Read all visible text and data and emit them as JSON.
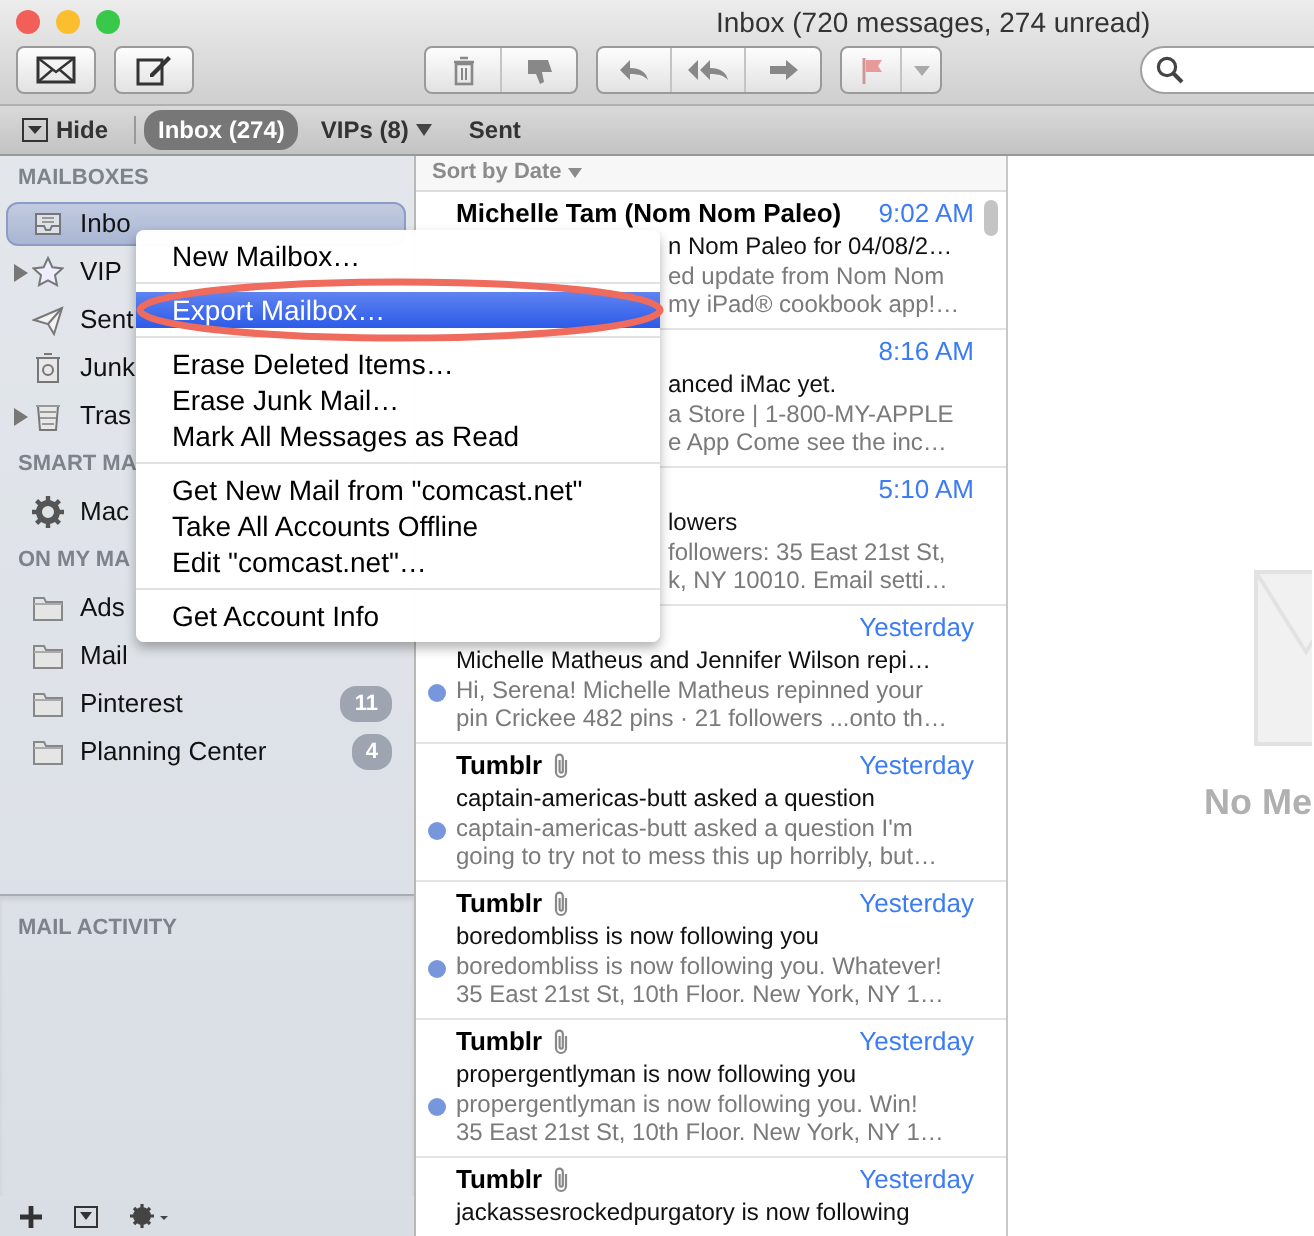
{
  "window": {
    "title": "Inbox (720 messages, 274 unread)"
  },
  "favorites_bar": {
    "hide": "Hide",
    "items": [
      {
        "label": "Inbox (274)",
        "selected": true,
        "has_menu": false
      },
      {
        "label": "VIPs (8)",
        "selected": false,
        "has_menu": true
      },
      {
        "label": "Sent",
        "selected": false,
        "has_menu": false
      }
    ]
  },
  "sidebar": {
    "sections": [
      {
        "heading": "MAILBOXES",
        "items": [
          {
            "label": "Inbo",
            "kind": "inbox",
            "selected": true,
            "disclosure": false
          },
          {
            "label": "VIP",
            "kind": "star",
            "selected": false,
            "disclosure": true
          },
          {
            "label": "Sent",
            "kind": "plane",
            "selected": false,
            "disclosure": false
          },
          {
            "label": "Junk",
            "kind": "junk",
            "selected": false,
            "disclosure": false
          },
          {
            "label": "Tras",
            "kind": "trash",
            "selected": false,
            "disclosure": true
          }
        ]
      },
      {
        "heading": "SMART MA",
        "items": [
          {
            "label": "Mac",
            "kind": "gear",
            "selected": false,
            "disclosure": false
          }
        ]
      },
      {
        "heading": "ON MY MA",
        "items": [
          {
            "label": "Ads",
            "kind": "folder",
            "selected": false,
            "disclosure": false
          },
          {
            "label": "Mail",
            "kind": "folder",
            "selected": false,
            "disclosure": false
          },
          {
            "label": "Pinterest",
            "kind": "folder",
            "selected": false,
            "disclosure": false,
            "count": "11"
          },
          {
            "label": "Planning Center",
            "kind": "folder",
            "selected": false,
            "disclosure": false,
            "count": "4"
          }
        ]
      }
    ],
    "activity_heading": "MAIL ACTIVITY"
  },
  "message_list": {
    "sort_label": "Sort by Date",
    "messages": [
      {
        "sender": "Michelle Tam (Nom Nom Paleo)",
        "time": "9:02 AM",
        "covered": true,
        "unread": false,
        "attachment": false,
        "subject": "n Nom Paleo for 04/08/2…",
        "lines": [
          "ed update from Nom Nom",
          "my iPad® cookbook app!…"
        ]
      },
      {
        "time": "8:16 AM",
        "covered": true,
        "unread": false,
        "attachment": false,
        "subject": "anced iMac yet.",
        "lines": [
          "a Store | 1-800-MY-APPLE",
          "e App Come see the inc…"
        ]
      },
      {
        "time": "5:10 AM",
        "covered": true,
        "unread": false,
        "attachment": false,
        "subject": "lowers",
        "lines": [
          "followers: 35 East 21st St,",
          "k, NY 10010. Email setti…"
        ]
      },
      {
        "time": "Yesterday",
        "covered": false,
        "unread": true,
        "attachment": false,
        "subject": "Michelle Matheus and Jennifer Wilson repi…",
        "lines": [
          "Hi, Serena! Michelle Matheus repinned your",
          "pin Crickee 482 pins · 21 followers ...onto th…"
        ]
      },
      {
        "sender": "Tumblr",
        "time": "Yesterday",
        "covered": false,
        "unread": true,
        "attachment": true,
        "subject": "captain-americas-butt asked a question",
        "lines": [
          "captain-americas-butt asked a question I'm",
          "going to try not to mess this up horribly, but…"
        ]
      },
      {
        "sender": "Tumblr",
        "time": "Yesterday",
        "covered": false,
        "unread": true,
        "attachment": true,
        "subject": "boredombliss is now following you",
        "lines": [
          "boredombliss is now following you. Whatever!",
          "35 East 21st St, 10th Floor. New York, NY 1…"
        ]
      },
      {
        "sender": "Tumblr",
        "time": "Yesterday",
        "covered": false,
        "unread": true,
        "attachment": true,
        "subject": "propergentlyman is now following you",
        "lines": [
          "propergentlyman is now following you. Win!",
          "35 East 21st St, 10th Floor. New York, NY 1…"
        ]
      },
      {
        "sender": "Tumblr",
        "time": "Yesterday",
        "covered": false,
        "unread": false,
        "attachment": true,
        "subject": "jackassesrockedpurgatory is now following"
      }
    ]
  },
  "viewer": {
    "empty_text": "No Me"
  },
  "context_menu": {
    "items": [
      {
        "kind": "item",
        "label": "New Mailbox…",
        "selected": false
      },
      {
        "kind": "separator"
      },
      {
        "kind": "item",
        "label": "Export Mailbox…",
        "selected": true
      },
      {
        "kind": "separator"
      },
      {
        "kind": "item",
        "label": "Erase Deleted Items…",
        "selected": false
      },
      {
        "kind": "item",
        "label": "Erase Junk Mail…",
        "selected": false
      },
      {
        "kind": "item",
        "label": "Mark All Messages as Read",
        "selected": false
      },
      {
        "kind": "separator"
      },
      {
        "kind": "item",
        "label": "Get New Mail from \"comcast.net\"",
        "selected": false
      },
      {
        "kind": "item",
        "label": "Take All Accounts Offline",
        "selected": false
      },
      {
        "kind": "item",
        "label": "Edit \"comcast.net\"…",
        "selected": false
      },
      {
        "kind": "separator"
      },
      {
        "kind": "item",
        "label": "Get Account Info",
        "selected": false
      }
    ]
  }
}
